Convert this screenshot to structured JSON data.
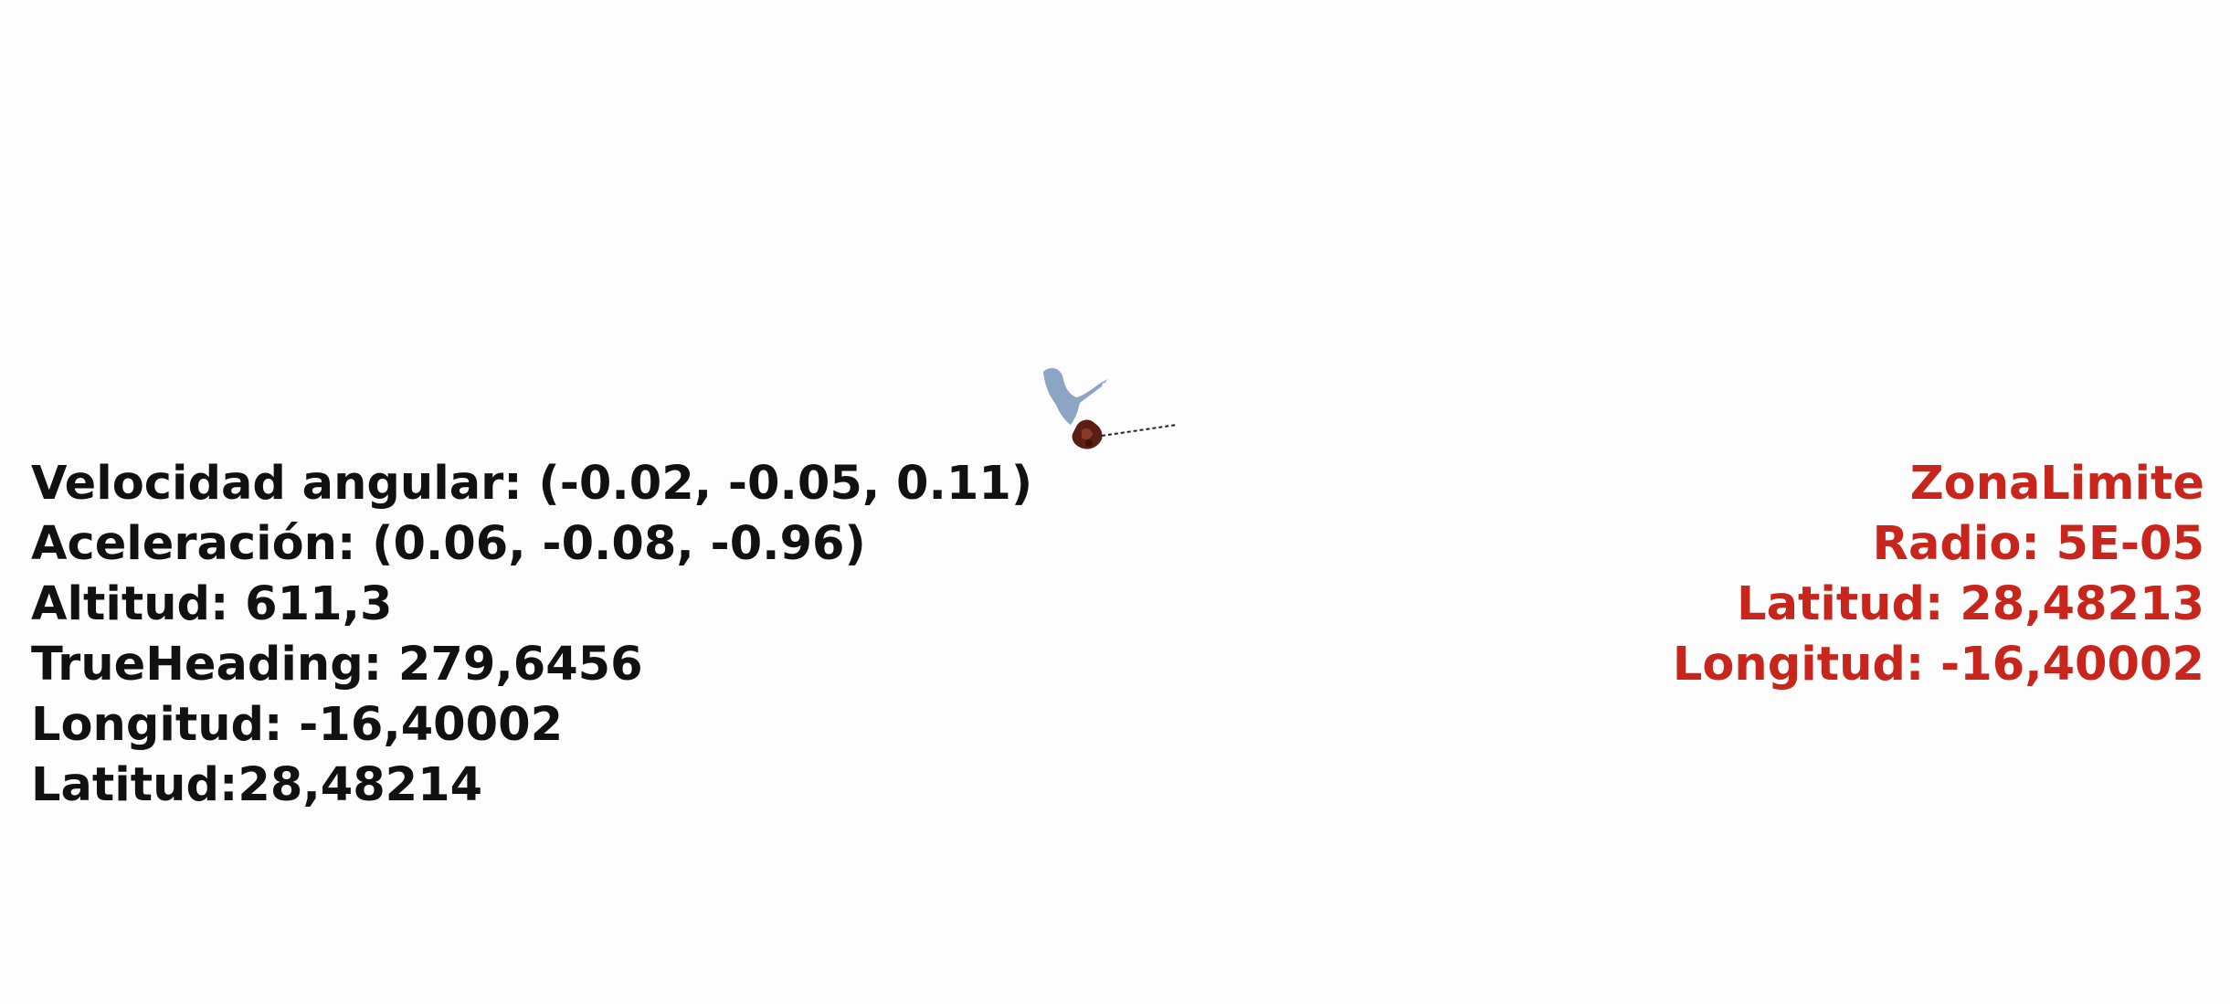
{
  "telemetry": {
    "velocidad_angular": "Velocidad angular: (-0.02, -0.05, 0.11)",
    "aceleracion": "Aceleración: (0.06, -0.08, -0.96)",
    "altitud": "Altitud: 611,3",
    "true_heading": "TrueHeading: 279,6456",
    "longitud": "Longitud: -16,40002",
    "latitud": "Latitud:28,48214"
  },
  "zone": {
    "title": "ZonaLimite",
    "radio": "Radio: 5E-05",
    "latitud": "Latitud: 28,48213",
    "longitud": "Longitud: -16,40002"
  },
  "colors": {
    "telemetry_text": "#111111",
    "zone_text": "#c8261c",
    "background": "#fdfdfd",
    "object_shadow": "#7f9bbf",
    "object_body": "#5a1e14"
  },
  "icons": {
    "scene_object": "drone-object-icon"
  }
}
